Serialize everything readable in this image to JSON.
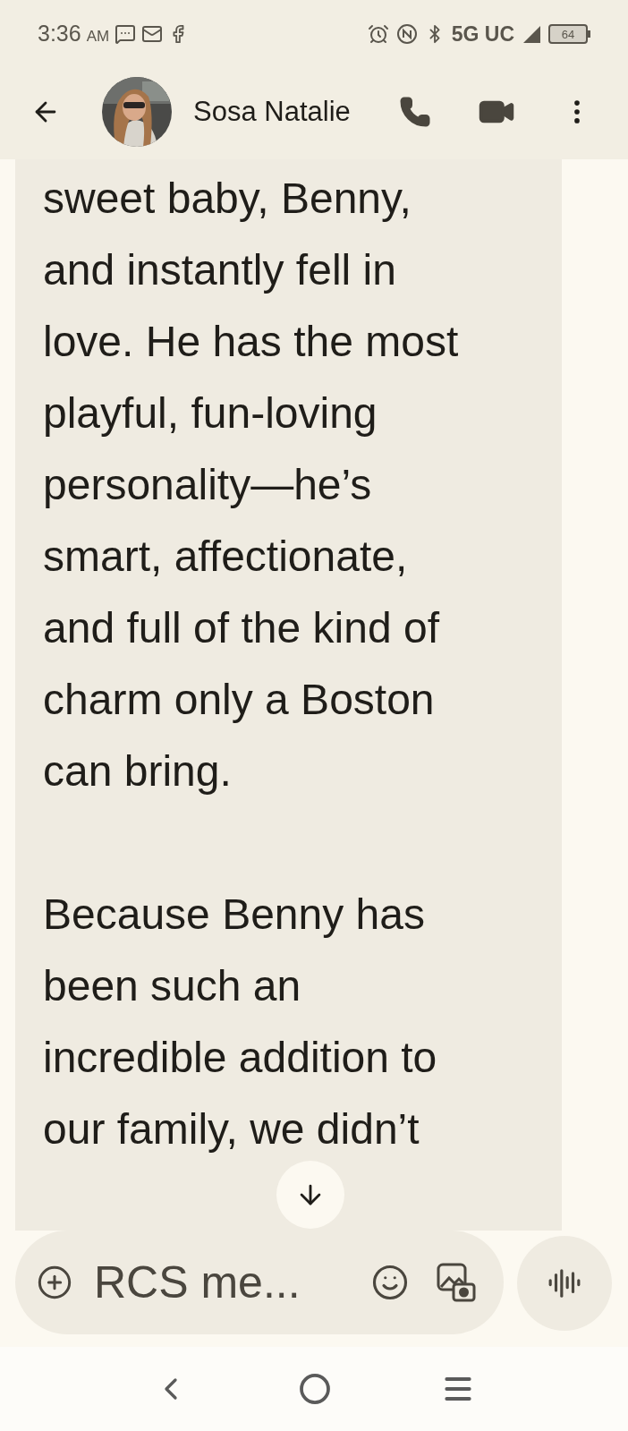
{
  "status_bar": {
    "time": "3:36",
    "meridiem": "AM",
    "network": "5G UC",
    "battery": "64"
  },
  "header": {
    "contact_name": "Sosa Natalie"
  },
  "message": {
    "paragraphs": [
      [
        "sweet baby, Benny,",
        "and instantly fell in",
        "love. He has the most",
        "playful, fun-loving",
        "personality—he’s",
        "smart, affectionate,",
        "and full of the kind of",
        "charm only a Boston",
        "can bring."
      ],
      [
        "Because Benny has",
        "been such an",
        "incredible addition to",
        "our family, we didn’t"
      ]
    ]
  },
  "composer": {
    "placeholder": "RCS me..."
  }
}
